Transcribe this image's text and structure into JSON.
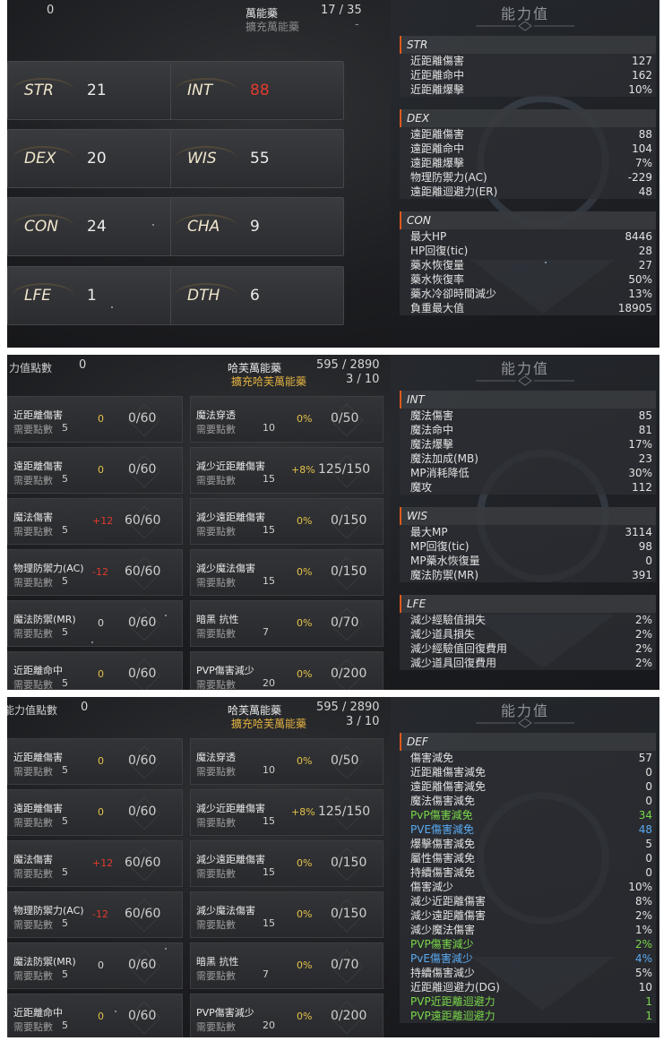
{
  "right_title": "能力值",
  "panel1": {
    "header": {
      "left_value": "0",
      "mid_label": "萬能藥",
      "mid_value": "17 / 35",
      "sub_label": "擴充萬能藥",
      "sub_value": "-"
    },
    "stats": [
      {
        "name": "STR",
        "value": "21",
        "red": false
      },
      {
        "name": "INT",
        "value": "88",
        "red": true
      },
      {
        "name": "DEX",
        "value": "20",
        "red": false
      },
      {
        "name": "WIS",
        "value": "55",
        "red": false
      },
      {
        "name": "CON",
        "value": "24",
        "red": false
      },
      {
        "name": "CHA",
        "value": "9",
        "red": false
      },
      {
        "name": "LFE",
        "value": "1",
        "red": false
      },
      {
        "name": "DTH",
        "value": "6",
        "red": false
      }
    ],
    "sections": [
      {
        "title": "STR",
        "rows": [
          {
            "label": "近距離傷害",
            "value": "127"
          },
          {
            "label": "近距離命中",
            "value": "162"
          },
          {
            "label": "近距離爆擊",
            "value": "10%"
          }
        ]
      },
      {
        "title": "DEX",
        "rows": [
          {
            "label": "遠距離傷害",
            "value": "88"
          },
          {
            "label": "遠距離命中",
            "value": "104"
          },
          {
            "label": "遠距離爆擊",
            "value": "7%"
          },
          {
            "label": "物理防禦力(AC)",
            "value": "-229"
          },
          {
            "label": "遠距離迴避力(ER)",
            "value": "48"
          }
        ]
      },
      {
        "title": "CON",
        "rows": [
          {
            "label": "最大HP",
            "value": "8446"
          },
          {
            "label": "HP回復(tic)",
            "value": "28"
          },
          {
            "label": "藥水恢復量",
            "value": "27"
          },
          {
            "label": "藥水恢復率",
            "value": "50%"
          },
          {
            "label": "藥水冷卻時間減少",
            "value": "13%"
          },
          {
            "label": "負重最大值",
            "value": "18905"
          }
        ]
      }
    ]
  },
  "panel2": {
    "header": {
      "left_label": "力值點數",
      "left_value": "0",
      "mid_label": "哈芙萬能藥",
      "mid_value": "595 / 2890",
      "sub_label": "擴充哈芙萬能藥",
      "sub_value": "3 / 10"
    },
    "sections": [
      {
        "title": "INT",
        "rows": [
          {
            "label": "魔法傷害",
            "value": "85"
          },
          {
            "label": "魔法命中",
            "value": "81"
          },
          {
            "label": "魔法爆擊",
            "value": "17%"
          },
          {
            "label": "魔法加成(MB)",
            "value": "23"
          },
          {
            "label": "MP消耗降低",
            "value": "30%"
          },
          {
            "label": "魔攻",
            "value": "112"
          }
        ]
      },
      {
        "title": "WIS",
        "rows": [
          {
            "label": "最大MP",
            "value": "3114"
          },
          {
            "label": "MP回復(tic)",
            "value": "98"
          },
          {
            "label": "MP藥水恢復量",
            "value": "0"
          },
          {
            "label": "魔法防禦(MR)",
            "value": "391"
          }
        ]
      },
      {
        "title": "LFE",
        "rows": [
          {
            "label": "減少經驗值損失",
            "value": "2%"
          },
          {
            "label": "減少道具損失",
            "value": "2%"
          },
          {
            "label": "減少經驗值回復費用",
            "value": "2%"
          },
          {
            "label": "減少道具回復費用",
            "value": "2%"
          }
        ]
      }
    ]
  },
  "panel3": {
    "header": {
      "left_label": "能力值點數",
      "left_value": "0",
      "mid_label": "哈芙萬能藥",
      "mid_value": "595 / 2890",
      "sub_label": "擴充哈芙萬能藥",
      "sub_value": "3 / 10"
    },
    "sections": [
      {
        "title": "DEF",
        "rows": [
          {
            "label": "傷害減免",
            "value": "57",
            "color": ""
          },
          {
            "label": "近距離傷害減免",
            "value": "0",
            "color": ""
          },
          {
            "label": "遠距離傷害減免",
            "value": "0",
            "color": ""
          },
          {
            "label": "魔法傷害減免",
            "value": "0",
            "color": ""
          },
          {
            "label": "PvP傷害減免",
            "value": "34",
            "color": "green"
          },
          {
            "label": "PVE傷害減免",
            "value": "48",
            "color": "blue"
          },
          {
            "label": "爆擊傷害減免",
            "value": "5",
            "color": ""
          },
          {
            "label": "屬性傷害減免",
            "value": "0",
            "color": ""
          },
          {
            "label": "持續傷害減免",
            "value": "0",
            "color": ""
          },
          {
            "label": "傷害減少",
            "value": "10%",
            "color": ""
          },
          {
            "label": "減少近距離傷害",
            "value": "8%",
            "color": ""
          },
          {
            "label": "減少遠距離傷害",
            "value": "2%",
            "color": ""
          },
          {
            "label": "減少魔法傷害",
            "value": "1%",
            "color": ""
          },
          {
            "label": "PVP傷害減少",
            "value": "2%",
            "color": "green"
          },
          {
            "label": "PvE傷害減少",
            "value": "4%",
            "color": "blue"
          },
          {
            "label": "持續傷害減少",
            "value": "5%",
            "color": ""
          },
          {
            "label": "近距離迴避力(DG)",
            "value": "10",
            "color": ""
          },
          {
            "label": "PVP近距離迴避力",
            "value": "1",
            "color": "green"
          },
          {
            "label": "PVP遠距離迴避力",
            "value": "1",
            "color": "green"
          }
        ]
      }
    ]
  },
  "skills": {
    "req_label": "需要點數",
    "left": [
      {
        "name": "近距離傷害",
        "bonus": "0",
        "bonus_style": "gold",
        "progress": "0/60",
        "req": "5"
      },
      {
        "name": "遠距離傷害",
        "bonus": "0",
        "bonus_style": "gold",
        "progress": "0/60",
        "req": "5"
      },
      {
        "name": "魔法傷害",
        "bonus": "+12",
        "bonus_style": "red",
        "progress": "60/60",
        "req": "5"
      },
      {
        "name": "物理防禦力(AC)",
        "bonus": "-12",
        "bonus_style": "red",
        "progress": "60/60",
        "req": "5"
      },
      {
        "name": "魔法防禦(MR)",
        "bonus": "0",
        "bonus_style": "plain",
        "progress": "0/60",
        "req": "5"
      },
      {
        "name": "近距離命中",
        "bonus": "0",
        "bonus_style": "gold",
        "progress": "0/60",
        "req": "5"
      }
    ],
    "right": [
      {
        "name": "魔法穿透",
        "bonus": "0%",
        "progress": "0/50",
        "req": "10"
      },
      {
        "name": "減少近距離傷害",
        "bonus": "+8%",
        "progress": "125/150",
        "req": "15"
      },
      {
        "name": "減少遠距離傷害",
        "bonus": "0%",
        "progress": "0/150",
        "req": "15"
      },
      {
        "name": "減少魔法傷害",
        "bonus": "0%",
        "progress": "0/150",
        "req": "15"
      },
      {
        "name": "暗黑 抗性",
        "bonus": "0%",
        "progress": "0/70",
        "req": "7"
      },
      {
        "name": "PVP傷害減少",
        "bonus": "0%",
        "progress": "0/200",
        "req": "20"
      }
    ]
  }
}
